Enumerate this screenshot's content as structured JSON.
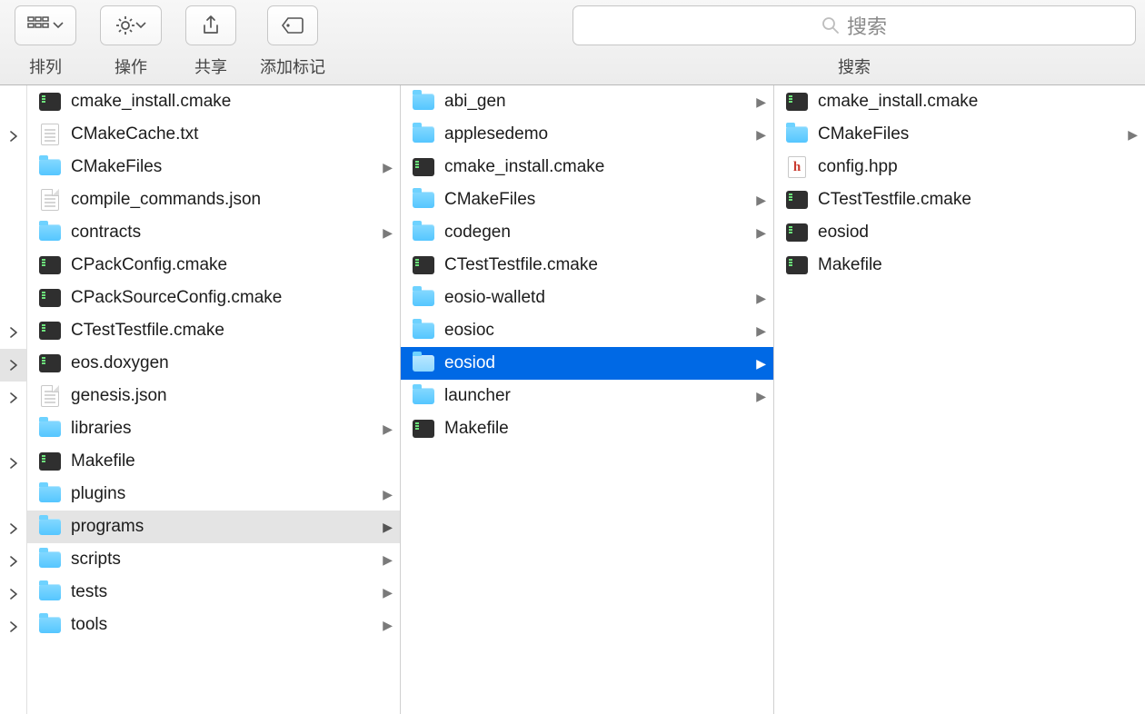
{
  "toolbar": {
    "arrange_label": "排列",
    "action_label": "操作",
    "share_label": "共享",
    "tag_label": "添加标记",
    "search_label": "搜索",
    "search_placeholder": "搜索"
  },
  "nav_arrows": [
    {
      "grey": false
    },
    {
      "grey": false
    },
    {
      "grey": false
    },
    {
      "grey": false
    },
    {
      "grey": false
    },
    {
      "grey": false
    },
    {
      "grey": false
    },
    {
      "grey": false
    },
    {
      "grey": true
    },
    {
      "grey": false
    },
    {
      "grey": false
    },
    {
      "grey": false
    },
    {
      "grey": false
    },
    {
      "grey": false
    },
    {
      "grey": false
    },
    {
      "grey": false
    },
    {
      "grey": false
    }
  ],
  "columns": [
    {
      "items": [
        {
          "name": "cmake_install.cmake",
          "kind": "term",
          "hasChildren": false
        },
        {
          "name": "CMakeCache.txt",
          "kind": "doc",
          "hasChildren": false
        },
        {
          "name": "CMakeFiles",
          "kind": "folder",
          "hasChildren": true
        },
        {
          "name": "compile_commands.json",
          "kind": "docfold",
          "hasChildren": false
        },
        {
          "name": "contracts",
          "kind": "folder",
          "hasChildren": true
        },
        {
          "name": "CPackConfig.cmake",
          "kind": "term",
          "hasChildren": false
        },
        {
          "name": "CPackSourceConfig.cmake",
          "kind": "term",
          "hasChildren": false
        },
        {
          "name": "CTestTestfile.cmake",
          "kind": "term",
          "hasChildren": false
        },
        {
          "name": "eos.doxygen",
          "kind": "term",
          "hasChildren": false
        },
        {
          "name": "genesis.json",
          "kind": "docfold",
          "hasChildren": false
        },
        {
          "name": "libraries",
          "kind": "folder",
          "hasChildren": true
        },
        {
          "name": "Makefile",
          "kind": "term",
          "hasChildren": false
        },
        {
          "name": "plugins",
          "kind": "folder",
          "hasChildren": true
        },
        {
          "name": "programs",
          "kind": "folder",
          "hasChildren": true,
          "selected": "grey"
        },
        {
          "name": "scripts",
          "kind": "folder",
          "hasChildren": true
        },
        {
          "name": "tests",
          "kind": "folder",
          "hasChildren": true
        },
        {
          "name": "tools",
          "kind": "folder",
          "hasChildren": true
        }
      ]
    },
    {
      "items": [
        {
          "name": "abi_gen",
          "kind": "folder",
          "hasChildren": true
        },
        {
          "name": "applesedemo",
          "kind": "folder",
          "hasChildren": true
        },
        {
          "name": "cmake_install.cmake",
          "kind": "term",
          "hasChildren": false
        },
        {
          "name": "CMakeFiles",
          "kind": "folder",
          "hasChildren": true
        },
        {
          "name": "codegen",
          "kind": "folder",
          "hasChildren": true
        },
        {
          "name": "CTestTestfile.cmake",
          "kind": "term",
          "hasChildren": false
        },
        {
          "name": "eosio-walletd",
          "kind": "folder",
          "hasChildren": true
        },
        {
          "name": "eosioc",
          "kind": "folder",
          "hasChildren": true
        },
        {
          "name": "eosiod",
          "kind": "folder",
          "hasChildren": true,
          "selected": "blue"
        },
        {
          "name": "launcher",
          "kind": "folder",
          "hasChildren": true
        },
        {
          "name": "Makefile",
          "kind": "term",
          "hasChildren": false
        }
      ]
    },
    {
      "items": [
        {
          "name": "cmake_install.cmake",
          "kind": "term",
          "hasChildren": false
        },
        {
          "name": "CMakeFiles",
          "kind": "folder",
          "hasChildren": true
        },
        {
          "name": "config.hpp",
          "kind": "hfile",
          "hasChildren": false
        },
        {
          "name": "CTestTestfile.cmake",
          "kind": "term",
          "hasChildren": false
        },
        {
          "name": "eosiod",
          "kind": "term",
          "hasChildren": false
        },
        {
          "name": "Makefile",
          "kind": "term",
          "hasChildren": false
        }
      ]
    }
  ]
}
